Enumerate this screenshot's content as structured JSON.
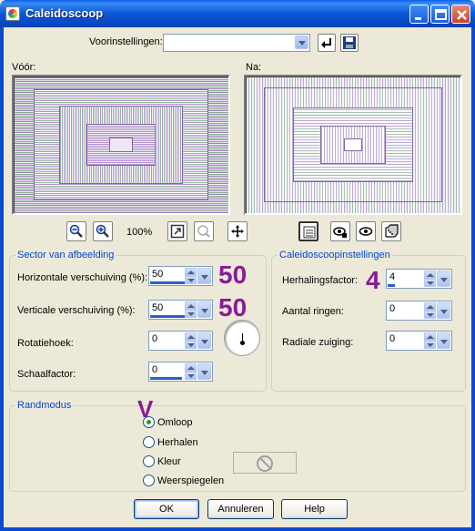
{
  "window": {
    "title": "Caleidoscoop"
  },
  "presets": {
    "label": "Voorinstellingen:",
    "value": ""
  },
  "previews": {
    "before_label": "Vóór:",
    "after_label": "Na:"
  },
  "zoom": {
    "level": "100%"
  },
  "sector": {
    "title": "Sector van afbeelding",
    "horizontal_label": "Horizontale verschuiving (%):",
    "horizontal_value": "50",
    "vertical_label": "Verticale verschuiving (%):",
    "vertical_value": "50",
    "rotation_label": "Rotatiehoek:",
    "rotation_value": "0",
    "scale_label": "Schaalfactor:",
    "scale_value": "0"
  },
  "kaleido": {
    "title": "Caleidoscoopinstellingen",
    "repeat_label": "Herhalingsfactor:",
    "repeat_value": "4",
    "rings_label": "Aantal ringen:",
    "rings_value": "0",
    "radial_label": "Radiale zuiging:",
    "radial_value": "0"
  },
  "annotations": {
    "a1": "50",
    "a2": "50",
    "a3": "4",
    "a4": "V"
  },
  "edge_mode": {
    "title": "Randmodus",
    "options": [
      "Omloop",
      "Herhalen",
      "Kleur",
      "Weerspiegelen"
    ],
    "selected": "Omloop"
  },
  "buttons": {
    "ok": "OK",
    "cancel": "Annuleren",
    "help": "Help"
  },
  "colors": {
    "titlebar": "#0a58d6",
    "group_title": "#0046d5",
    "annotation": "#8b1a93"
  }
}
